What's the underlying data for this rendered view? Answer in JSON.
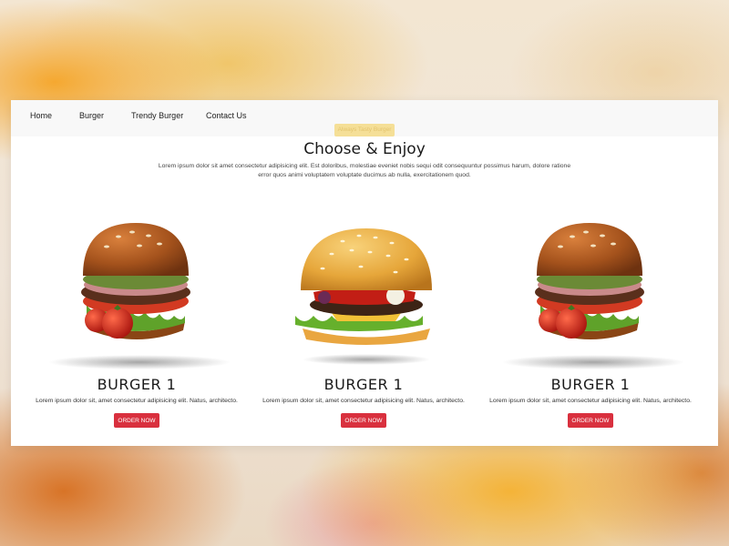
{
  "nav": {
    "items": [
      {
        "label": "Home"
      },
      {
        "label": "Burger"
      },
      {
        "label": "Trendy Burger"
      },
      {
        "label": "Contact Us"
      }
    ]
  },
  "hero": {
    "tagline": "Always Tasty Burger",
    "title": "Choose & Enjoy",
    "description": "Lorem ipsum dolor sit amet consectetur adipisicing elit. Est doloribus, molestiae eveniet nobis sequi odit consequuntur possimus harum, dolore ratione error quos animi voluptatem voluptate ducimus ab nulla, exercitationem quod."
  },
  "products": [
    {
      "name": "BURGER 1",
      "description": "Lorem ipsum dolor sit, amet consectetur adipisicing elit. Natus, architecto.",
      "button": "ORDER NOW",
      "image": "deli-burger-with-tomatoes"
    },
    {
      "name": "BURGER 1",
      "description": "Lorem ipsum dolor sit, amet consectetur adipisicing elit. Natus, architecto.",
      "button": "ORDER NOW",
      "image": "sesame-cheeseburger"
    },
    {
      "name": "BURGER 1",
      "description": "Lorem ipsum dolor sit, amet consectetur adipisicing elit. Natus, architecto.",
      "button": "ORDER NOW",
      "image": "deli-burger-with-tomatoes"
    }
  ],
  "colors": {
    "accent": "#d9303e",
    "tagline_bg": "#f5df97",
    "navbar_bg": "#f8f8f8"
  }
}
